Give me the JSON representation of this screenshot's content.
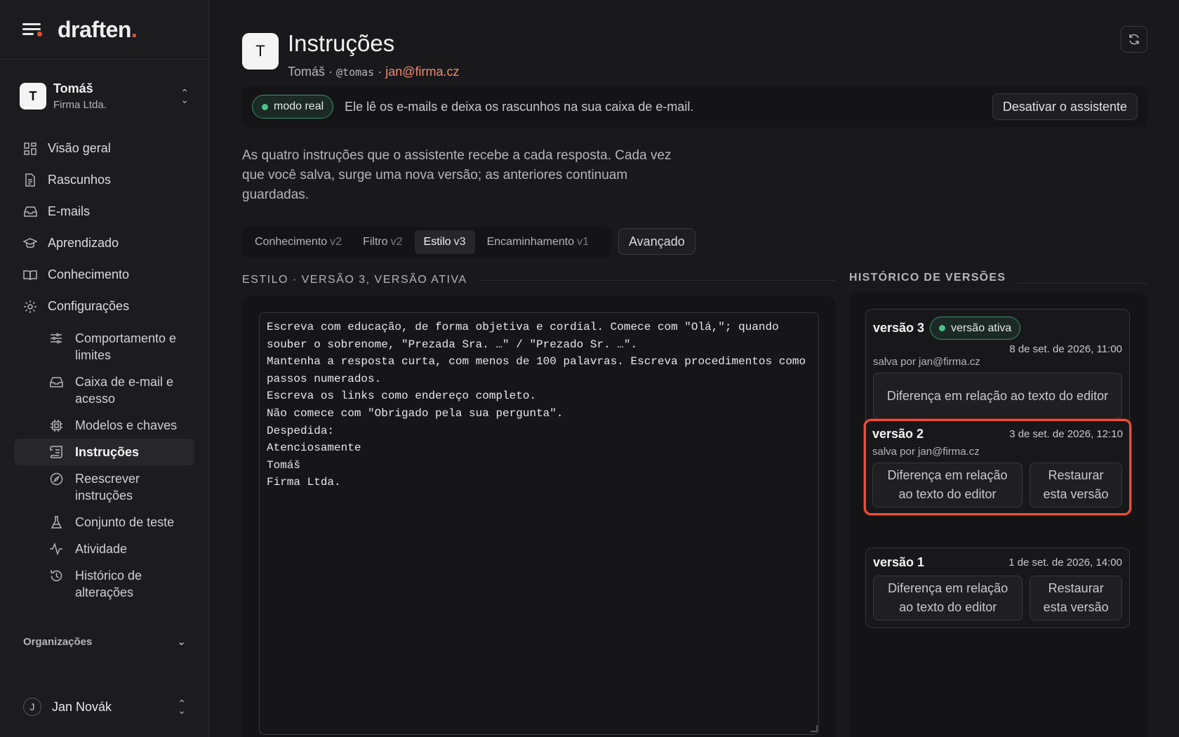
{
  "brand": {
    "name": "draften",
    "dot": "."
  },
  "account": {
    "initial": "T",
    "name": "Tomáš",
    "org": "Firma Ltda."
  },
  "nav": [
    {
      "label": "Visão geral",
      "icon": "grid-icon"
    },
    {
      "label": "Rascunhos",
      "icon": "document-icon"
    },
    {
      "label": "E-mails",
      "icon": "inbox-icon"
    },
    {
      "label": "Aprendizado",
      "icon": "graduation-cap-icon"
    },
    {
      "label": "Conhecimento",
      "icon": "book-icon"
    },
    {
      "label": "Configurações",
      "icon": "gear-icon"
    }
  ],
  "subnav": [
    {
      "label": "Comportamento e limites",
      "icon": "sliders-icon"
    },
    {
      "label": "Caixa de e-mail e acesso",
      "icon": "inbox-icon"
    },
    {
      "label": "Modelos e chaves",
      "icon": "chip-icon"
    },
    {
      "label": "Instruções",
      "icon": "scroll-icon"
    },
    {
      "label": "Reescrever instruções",
      "icon": "compass-icon"
    },
    {
      "label": "Conjunto de teste",
      "icon": "flask-icon"
    },
    {
      "label": "Atividade",
      "icon": "activity-icon"
    },
    {
      "label": "Histórico de alterações",
      "icon": "history-icon"
    }
  ],
  "orgs_label": "Organizações",
  "user": {
    "initial": "J",
    "name": "Jan Novák"
  },
  "header": {
    "initial": "T",
    "title": "Instruções",
    "name": "Tomáš",
    "sep1": " · ",
    "handle": "@tomas",
    "sep2": " · ",
    "email": "jan@firma.cz"
  },
  "banner": {
    "mode": "modo real",
    "text": "Ele lê os e-mails e deixa os rascunhos na sua caixa de e-mail.",
    "button": "Desativar o assistente"
  },
  "intro": "As quatro instruções que o assistente recebe a cada resposta. Cada vez que você salva, surge uma nova versão; as anteriores continuam guardadas.",
  "tabs": [
    {
      "label": "Conhecimento",
      "ver": "v2"
    },
    {
      "label": "Filtro",
      "ver": "v2"
    },
    {
      "label": "Estilo",
      "ver": "v3"
    },
    {
      "label": "Encaminhamento",
      "ver": "v1"
    }
  ],
  "advanced": "Avançado",
  "section_title": "ESTILO · VERSÃO 3, VERSÃO ATIVA",
  "editor_text": "Escreva com educação, de forma objetiva e cordial. Comece com \"Olá,\"; quando souber o sobrenome, \"Prezada Sra. …\" / \"Prezado Sr. …\".\nMantenha a resposta curta, com menos de 100 palavras. Escreva procedimentos como passos numerados.\nEscreva os links como endereço completo.\nNão comece com \"Obrigado pela sua pergunta\".\nDespedida:\nAtenciosamente\nTomáš\nFirma Ltda.",
  "history_title": "HISTÓRICO DE VERSÕES",
  "versions": [
    {
      "title": "versão 3",
      "active_label": "versão ativa",
      "date": "8 de set. de 2026, 11:00",
      "by": "salva por jan@firma.cz",
      "diff": "Diferença em relação ao texto do editor"
    },
    {
      "title": "versão 2",
      "date": "3 de set. de 2026, 12:10",
      "by": "salva por jan@firma.cz",
      "diff": "Diferença em relação ao texto do editor",
      "restore": "Restaurar esta versão"
    },
    {
      "title": "versão 1",
      "date": "1 de set. de 2026, 14:00",
      "diff": "Diferença em relação ao texto do editor",
      "restore": "Restaurar esta versão"
    }
  ],
  "colors": {
    "accent": "#ef4d36",
    "live": "#4cc38a",
    "email": "#f08a70"
  }
}
